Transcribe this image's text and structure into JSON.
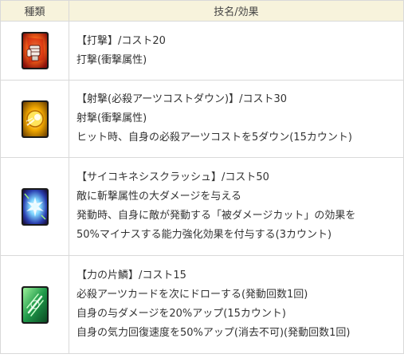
{
  "table": {
    "headers": {
      "type": "種類",
      "skill": "技名/効果"
    },
    "rows": [
      {
        "icon": "fist-card-icon",
        "lines": [
          "【打撃】/コスト20",
          "打撃(衝撃属性)"
        ]
      },
      {
        "icon": "shot-card-icon",
        "lines": [
          "【射撃(必殺アーツコストダウン)】/コスト30",
          "射撃(衝撃属性)",
          "ヒット時、自身の必殺アーツコストを5ダウン(15カウント)"
        ]
      },
      {
        "icon": "psychokinesis-card-icon",
        "lines": [
          "【サイコキネシスクラッシュ】/コスト50",
          "敵に斬撃属性の大ダメージを与える",
          "発動時、自身に敵が発動する「被ダメージカット」の効果を",
          "50%マイナスする能力強化効果を付与する(3カウント)"
        ]
      },
      {
        "icon": "power-scale-card-icon",
        "lines": [
          "【力の片鱗】/コスト15",
          "必殺アーツカードを次にドローする(発動回数1回)",
          "自身の与ダメージを20%アップ(15カウント)",
          "自身の気力回復速度を50%アップ(消去不可)(発動回数1回)"
        ]
      }
    ]
  }
}
